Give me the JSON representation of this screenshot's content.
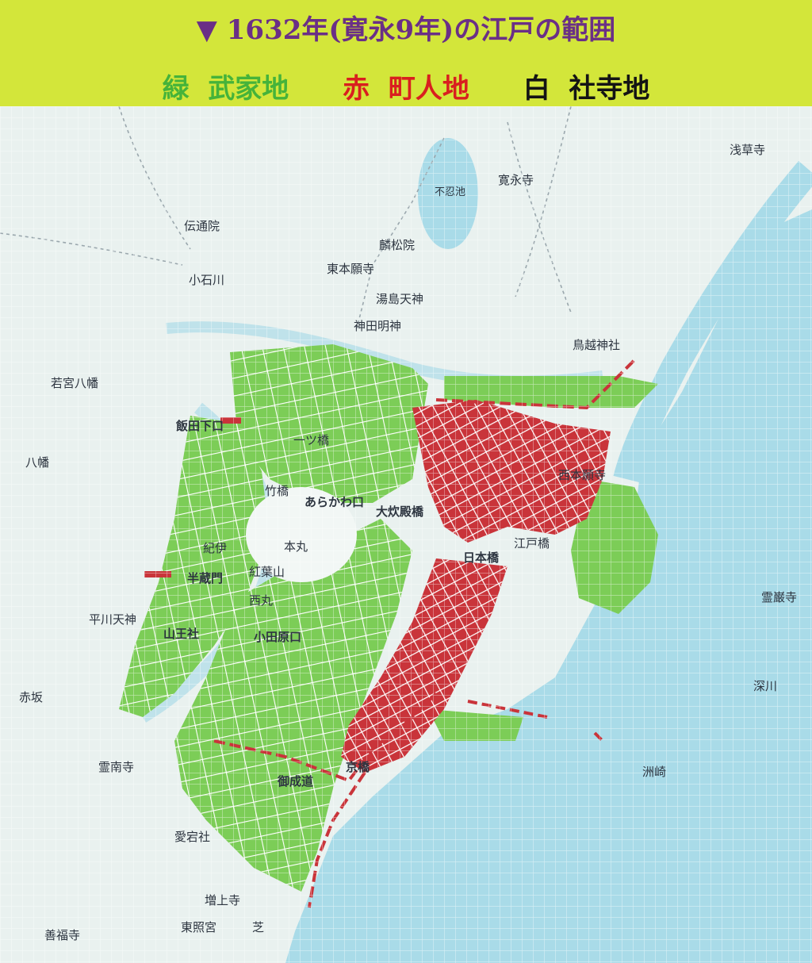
{
  "header": {
    "marker": "▼",
    "title": "1632年(寛永9年)の江戸の範囲",
    "title_color": "#6a2f86",
    "background": "#d3e63a"
  },
  "legend": [
    {
      "color_name": "緑",
      "label": "武家地",
      "color": "#45b33a"
    },
    {
      "color_name": "赤",
      "label": "町人地",
      "color": "#d91f1f"
    },
    {
      "color_name": "白",
      "label": "社寺地",
      "color": "#141414"
    }
  ],
  "map": {
    "land_color": "#e9f1ef",
    "water_color": "#a9dbe8",
    "samurai_color": "#7ccd57",
    "merchant_color": "#c9343a",
    "labels": {
      "asakusa": "浅草寺",
      "kaneiji": "寛永寺",
      "shinobazu": "不忍池",
      "dentsuin": "伝通院",
      "girinshoin": "麟松院",
      "higashi_honganji": "東本願寺",
      "yushima": "湯島天神",
      "kanda_myojin": "神田明神",
      "torigoe": "鳥越神社",
      "koishikawa": "小石川",
      "wakamiya": "若宮八幡",
      "hachiman": "八幡",
      "iidabashi": "飯田下口",
      "hitotsubashi": "一ツ橋",
      "nishi_honganji": "西本願寺",
      "takebashi": "竹橋",
      "arakawa": "あらかわ口",
      "ote": "大炊殿橋",
      "honmaru": "本丸",
      "kii": "紀伊",
      "momijiyama": "紅葉山",
      "hanzomon": "半蔵門",
      "nishinomaru": "西丸",
      "hirakawa": "平川天神",
      "sanno": "山王社",
      "odawara": "小田原口",
      "akasaka": "赤坂",
      "reinanji": "霊南寺",
      "atago": "愛宕社",
      "zojoji": "増上寺",
      "toshogu": "東照宮",
      "zenpukuji": "善福寺",
      "nihonbashi": "日本橋",
      "edobashi": "江戸橋",
      "reiganji": "霊巌寺",
      "fukagawa": "深川",
      "shiba": "芝",
      "onarimichi": "御成道",
      "kyobashi": "京橋",
      "senzoku": "洲崎"
    }
  }
}
